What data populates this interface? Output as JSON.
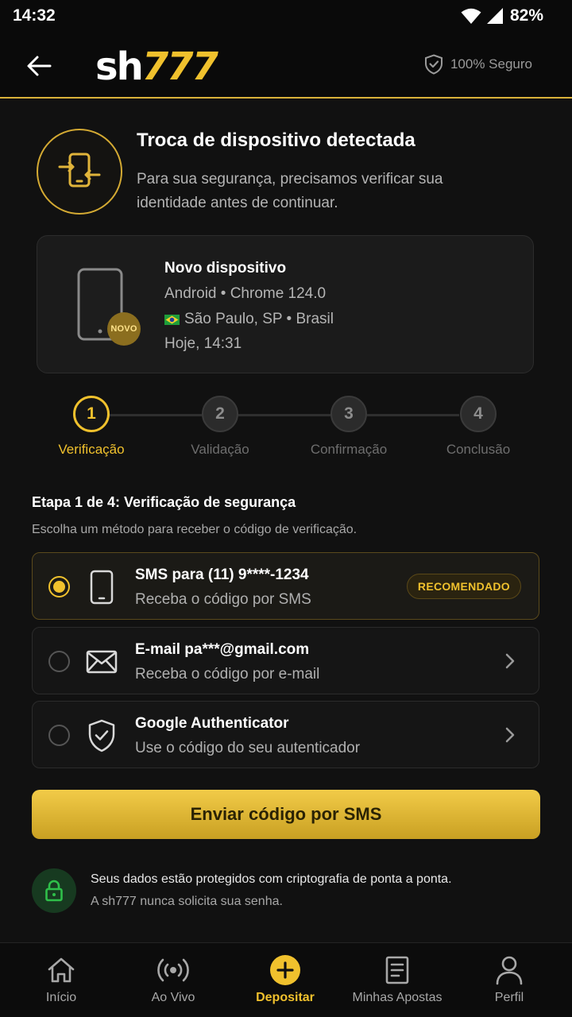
{
  "status_bar": {
    "time": "14:32",
    "battery": "82%"
  },
  "header": {
    "logo_sh": "sh",
    "logo_num": "777",
    "secure_label": "100% Seguro"
  },
  "detection": {
    "title": "Troca de dispositivo detectada",
    "description": "Para sua segurança, precisamos verificar sua identidade antes de continuar."
  },
  "device": {
    "badge": "NOVO",
    "name": "Novo dispositivo",
    "system": "Android • Chrome 124.0",
    "location": "São Paulo, SP • Brasil",
    "time": "Hoje, 14:31"
  },
  "stepper": {
    "steps": [
      {
        "number": "1",
        "label": "Verificação",
        "active": true
      },
      {
        "number": "2",
        "label": "Validação",
        "active": false
      },
      {
        "number": "3",
        "label": "Confirmação",
        "active": false
      },
      {
        "number": "4",
        "label": "Conclusão",
        "active": false
      }
    ]
  },
  "section": {
    "title": "Etapa 1 de 4: Verificação de segurança",
    "subtitle": "Escolha um método para receber o código de verificação."
  },
  "options": [
    {
      "icon": "smartphone-icon",
      "title": "SMS para (11) 9****-1234",
      "subtitle": "Receba o código por SMS",
      "badge": "RECOMENDADO",
      "selected": true
    },
    {
      "icon": "mail-icon",
      "title": "E-mail pa***@gmail.com",
      "subtitle": "Receba o código por e-mail",
      "selected": false
    },
    {
      "icon": "shield-check-icon",
      "title": "Google Authenticator",
      "subtitle": "Use o código do seu autenticador",
      "selected": false
    }
  ],
  "cta": {
    "label": "Enviar código por SMS"
  },
  "security_note": {
    "line1": "Seus dados estão protegidos com criptografia de ponta a ponta.",
    "line2": "A sh777 nunca solicita sua senha."
  },
  "bottom_nav": {
    "items": [
      {
        "icon": "home-icon",
        "label": "Início",
        "active": false
      },
      {
        "icon": "live-broadcast-icon",
        "label": "Ao Vivo",
        "active": false
      },
      {
        "icon": "plus-circle-icon",
        "label": "Depositar",
        "active": true
      },
      {
        "icon": "bet-slip-icon",
        "label": "Minhas Apostas",
        "active": false
      },
      {
        "icon": "user-icon",
        "label": "Perfil",
        "active": false
      }
    ]
  },
  "colors": {
    "accent": "#f0c12d",
    "background": "#111111",
    "card": "#1b1b1b",
    "success": "#2fbf4a"
  }
}
